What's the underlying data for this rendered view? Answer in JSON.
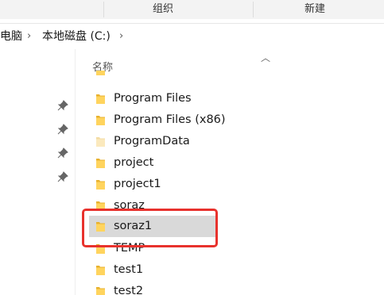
{
  "ribbon": {
    "organize": "组织",
    "new": "新建"
  },
  "breadcrumb": {
    "pc": "电脑",
    "drive": "本地磁盘 (C:)"
  },
  "column": {
    "name": "名称"
  },
  "files": [
    {
      "name": "Program Files",
      "icon": "folder-icon"
    },
    {
      "name": "Program Files (x86)",
      "icon": "folder-icon"
    },
    {
      "name": "ProgramData",
      "icon": "folder-hidden-icon"
    },
    {
      "name": "project",
      "icon": "folder-icon"
    },
    {
      "name": "project1",
      "icon": "folder-icon"
    },
    {
      "name": "soraz",
      "icon": "folder-icon"
    },
    {
      "name": "soraz1",
      "icon": "folder-icon",
      "selected": true
    },
    {
      "name": "TEMP",
      "icon": "folder-icon"
    },
    {
      "name": "test1",
      "icon": "folder-icon"
    },
    {
      "name": "test2",
      "icon": "folder-icon"
    }
  ],
  "colors": {
    "highlight": "#e8322d",
    "folder": "#f5c542",
    "selected_row": "#d9d9d9"
  }
}
